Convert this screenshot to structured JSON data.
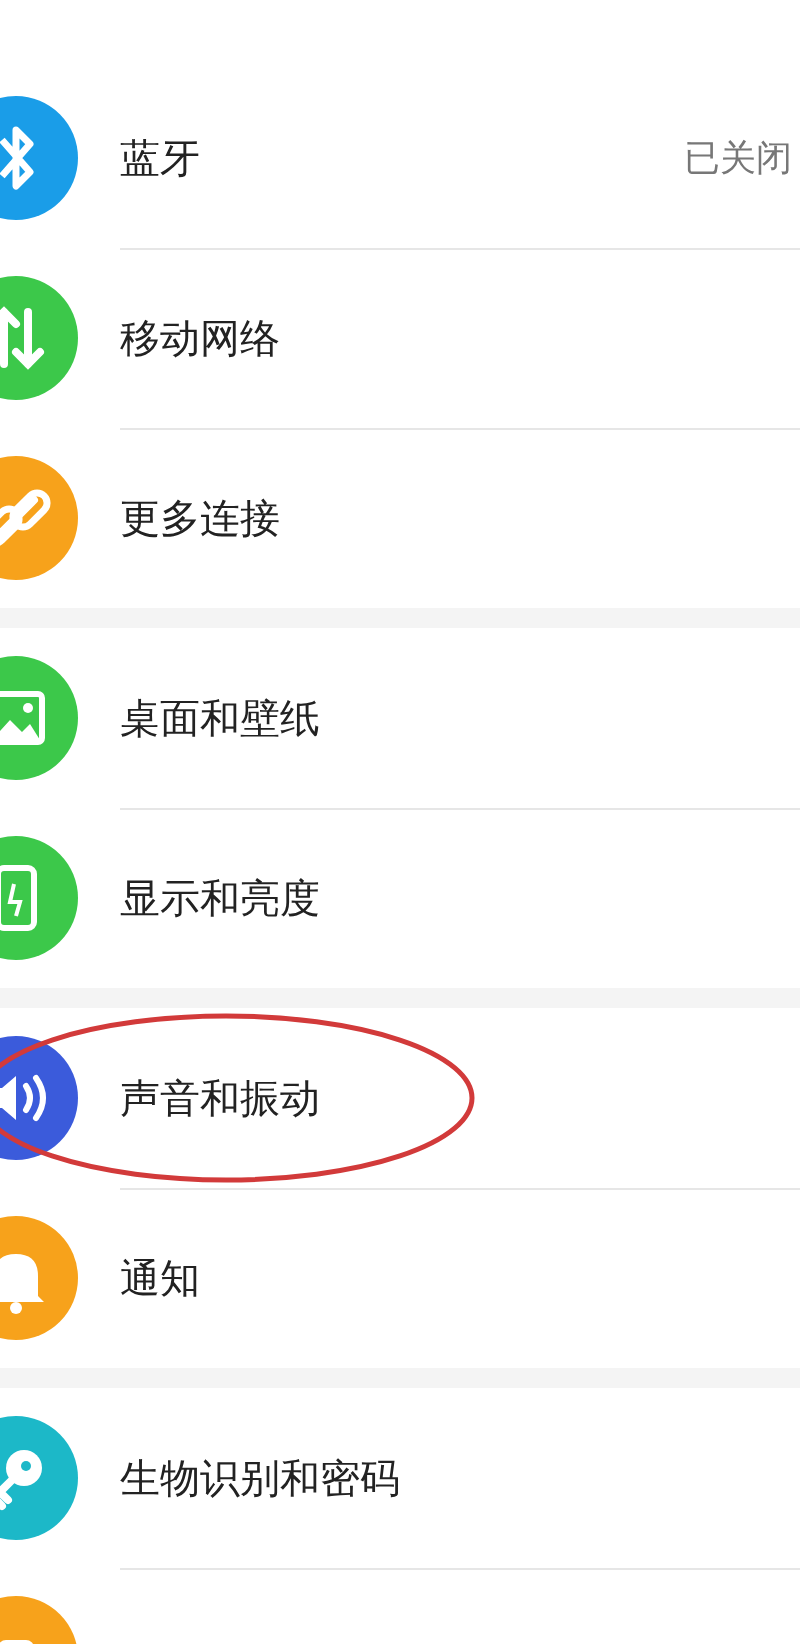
{
  "groups": [
    {
      "items": [
        {
          "kind": "bluetooth",
          "color": "#1a9de8",
          "label": "蓝牙",
          "value": "已关闭"
        },
        {
          "kind": "network",
          "color": "#3cc84a",
          "label": "移动网络"
        },
        {
          "kind": "link",
          "color": "#f7a21b",
          "label": "更多连接"
        }
      ]
    },
    {
      "items": [
        {
          "kind": "wallpaper",
          "color": "#3cc84a",
          "label": "桌面和壁纸"
        },
        {
          "kind": "display",
          "color": "#3cc84a",
          "label": "显示和亮度"
        }
      ]
    },
    {
      "items": [
        {
          "kind": "sound",
          "color": "#3b5bdb",
          "label": "声音和振动",
          "highlighted": true
        },
        {
          "kind": "bell",
          "color": "#f7a21b",
          "label": "通知"
        }
      ]
    },
    {
      "items": [
        {
          "kind": "key",
          "color": "#1cb8c8",
          "label": "生物识别和密码"
        },
        {
          "kind": "generic",
          "color": "#f7a21b"
        }
      ]
    }
  ]
}
